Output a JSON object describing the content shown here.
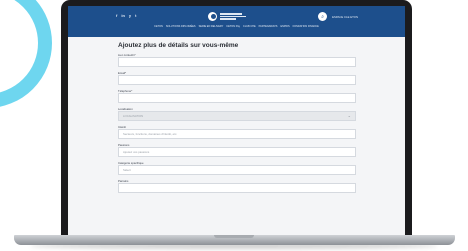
{
  "topbar": {
    "social": [
      "f",
      "in",
      "y",
      "t"
    ],
    "search_icon": "search-icon",
    "account_label": "ESPACE CLE ETON"
  },
  "nav": {
    "items": [
      "CETON",
      "SOLUTIONS DIPLOMÉES",
      "SERIE EN DELIVERY",
      "CETON Pay",
      "CLUB CHE",
      "PARTENARIATS",
      "ESPIDS",
      "FONDATION FINANCE"
    ]
  },
  "form": {
    "title": "Ajoutez plus de détails sur vous-même",
    "fields": [
      {
        "label": "Lien Linkedin*",
        "value": ""
      },
      {
        "label": "Email*",
        "value": ""
      },
      {
        "label": "Téléphone*",
        "value": ""
      },
      {
        "label": "Localisation",
        "value": "LOCALISATION"
      },
      {
        "label": "Intérêt",
        "value": "Secteurs, fonctions, domaines d'intérêt, etc."
      },
      {
        "label": "Passions",
        "value": "Ajoutez vos passions"
      },
      {
        "label": "Catégorie spécifique",
        "value": "Sélect"
      },
      {
        "label": "Parrains",
        "value": ""
      }
    ]
  },
  "colors": {
    "header": "#1d4f8c",
    "accent": "#6ed6ef"
  }
}
